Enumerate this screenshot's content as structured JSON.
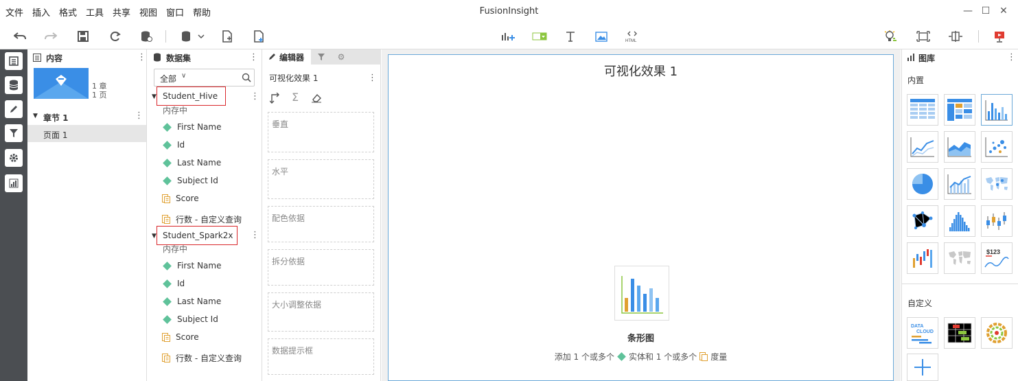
{
  "menu": [
    "文件",
    "插入",
    "格式",
    "工具",
    "共享",
    "视图",
    "窗口",
    "帮助"
  ],
  "app_title": "FusionInsight",
  "content_panel": {
    "title": "内容",
    "thumb_counts": [
      "1 章",
      "1 页"
    ],
    "chapter": "章节 1",
    "page": "页面 1"
  },
  "dataset_panel": {
    "title": "数据集",
    "filter_value": "全部",
    "datasets": [
      {
        "name": "Student_Hive",
        "status": "内存中",
        "fields": [
          {
            "label": "First Name",
            "kind": "dimension"
          },
          {
            "label": "Id",
            "kind": "dimension"
          },
          {
            "label": "Last Name",
            "kind": "dimension"
          },
          {
            "label": "Subject Id",
            "kind": "dimension"
          },
          {
            "label": "Score",
            "kind": "measure"
          },
          {
            "label": "行数 - 自定义查询",
            "kind": "measure"
          }
        ]
      },
      {
        "name": "Student_Spark2x",
        "status": "内存中",
        "fields": [
          {
            "label": "First Name",
            "kind": "dimension"
          },
          {
            "label": "Id",
            "kind": "dimension"
          },
          {
            "label": "Last Name",
            "kind": "dimension"
          },
          {
            "label": "Subject Id",
            "kind": "dimension"
          },
          {
            "label": "Score",
            "kind": "measure"
          },
          {
            "label": "行数 - 自定义查询",
            "kind": "measure"
          }
        ]
      }
    ]
  },
  "editor_panel": {
    "tab_label": "编辑器",
    "visual_name": "可视化效果 1",
    "shelves": [
      "垂直",
      "水平",
      "配色依据",
      "拆分依据",
      "大小调整依据",
      "数据提示框"
    ]
  },
  "canvas": {
    "title": "可视化效果 1",
    "chart_name": "条形图",
    "hint_part1": "添加 1 个或多个",
    "hint_part2": "实体和 1 个或多个",
    "hint_part3": "度量"
  },
  "gallery": {
    "title": "图库",
    "builtin_label": "内置",
    "custom_label": "自定义"
  },
  "colors": {
    "accent": "#3a8ee6",
    "dimension": "#5fc29a",
    "measure": "#e0a030",
    "highlight": "#d9262b",
    "rail": "#4b4e52"
  }
}
